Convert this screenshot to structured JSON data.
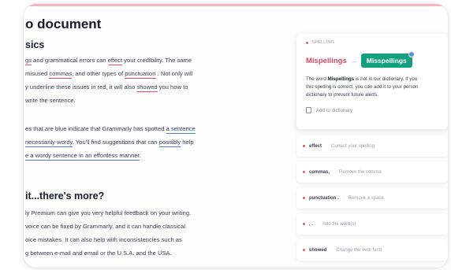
{
  "document": {
    "title": "o document",
    "section1": {
      "title": "sics",
      "p1": [
        [
          {
            "t": "gs",
            "u": "red"
          },
          {
            "t": " and grammatical errors can "
          },
          {
            "t": "effect",
            "u": "red"
          },
          {
            "t": " your credibility. The same"
          }
        ],
        [
          {
            "t": " misused "
          },
          {
            "t": "commas",
            "u": "red"
          },
          {
            "t": ", and other types of "
          },
          {
            "t": "punctuation",
            "u": "red"
          },
          {
            "t": " . Not only will"
          }
        ],
        [
          {
            "t": "y underline these issues in red, it will also "
          },
          {
            "t": "showed",
            "u": "red"
          },
          {
            "t": " you how to"
          }
        ],
        [
          {
            "t": " write the sentence."
          }
        ]
      ],
      "p2": [
        [
          {
            "t": "es that are blue indicate that Grammarly has spotted "
          },
          {
            "t": "a sentence",
            "u": "blue"
          }
        ],
        [
          {
            "t": "necessarily wordy",
            "u": "blue"
          },
          {
            "t": ". You'll find suggestions that can "
          },
          {
            "t": "possibly",
            "u": "blue"
          },
          {
            "t": " help"
          }
        ],
        [
          {
            "t": "e a wordy sentence in an effortless manner",
            "u": "blue"
          },
          {
            "t": "."
          }
        ]
      ]
    },
    "section2": {
      "title": "it...there's more?",
      "p1": [
        [
          {
            "t": "ly Premium can give you very helpful feedback on your writing."
          }
        ],
        [
          {
            "t": " voice can be fixed by Grammarly, and it can handle classical"
          }
        ],
        [
          {
            "t": " oice mistakes. It can also help with inconsistencies such as"
          }
        ],
        [
          {
            "t": "g between e-mail and email or the U.S.A. and the USA."
          }
        ]
      ]
    }
  },
  "sidebar": {
    "alert": {
      "category": "SPELLING",
      "word": "Mispellings",
      "arrow": "→",
      "replacement": "Misspellings",
      "body": [
        [
          {
            "t": "The word "
          },
          {
            "t": "Mispellings",
            "b": true
          },
          {
            "t": " is not in our dictionary. If you"
          }
        ],
        [
          {
            "t": "this spelling is correct, you can add it to your person"
          }
        ],
        [
          {
            "t": "dictionary to prevent future alerts."
          }
        ]
      ],
      "add_label": "Add to dictionary"
    },
    "suggestions": [
      {
        "word": "effect",
        "desc": "Correct your spelling"
      },
      {
        "word": "commas,",
        "desc": "Remove the comma"
      },
      {
        "word": "punctuation .",
        "desc": "Remove a space"
      },
      {
        "word": ", .",
        "desc": "Add the word(s)"
      },
      {
        "word": "showed",
        "desc": "Change the verb form"
      }
    ]
  },
  "colors": {
    "error_underline": "#e0556c",
    "clarity_underline": "#4a7fd6",
    "accept_button": "#13a17d"
  }
}
